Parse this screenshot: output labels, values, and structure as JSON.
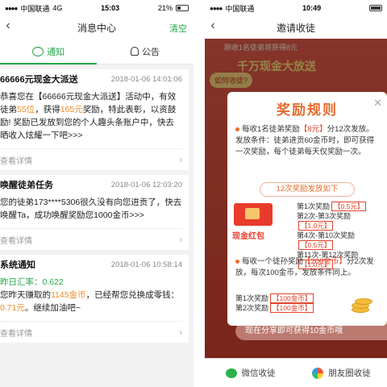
{
  "left": {
    "status": {
      "carrier": "中国联通",
      "network": "4G",
      "time": "15:03",
      "battery": "21%"
    },
    "nav": {
      "title": "消息中心",
      "action": "清空"
    },
    "tabs": [
      {
        "label": "通知"
      },
      {
        "label": "公告"
      }
    ],
    "cards": [
      {
        "title": "66666元现金大派送",
        "time": "2018-01-06 14:01:06",
        "body_parts": [
          "恭喜您在【66666元现金大派送】活动中，有效徒弟",
          "55位",
          "，获得",
          "165元",
          "奖励，特此表彰，以资鼓励! 奖励已发放到您的个人趣头条账户中，快去晒收入炫耀一下吧>>>"
        ],
        "more": "查看详情"
      },
      {
        "title": "唤醒徒弟任务",
        "time": "2018-01-06 12:03:20",
        "body": "您的徒弟173****5306很久没有向您进贡了，快去唤醒Ta，成功唤醒奖励您1000金币>>>",
        "more": "查看详情"
      },
      {
        "title": "系统通知",
        "time": "2018-01-06 10:58:14",
        "rate_label": "昨日汇率：0.622",
        "body_parts": [
          "您昨天赚取的",
          "1145金币",
          "，已经帮您兑换成零钱：",
          "0.71元",
          "。继续加油吧~"
        ],
        "more": "查看详情"
      }
    ]
  },
  "right": {
    "status": {
      "carrier": "中国联通",
      "time": "10:49"
    },
    "nav": {
      "title": "邀请收徒"
    },
    "ticker": "刚收1名徒弟将获得8元",
    "banner_title": "千万现金大放送",
    "how_label": "如何收徒?",
    "modal": {
      "title": "奖励规则",
      "rule1_parts": [
        "每收1名徒弟奖励",
        "【8元】",
        "分12次发放。发放条件：徒弟进贡60金币时，即可获得一次奖励，每个徒弟每天仅奖励一次。"
      ],
      "pill": "12次奖励发放如下",
      "list": [
        {
          "label": "第1次奖励",
          "value": "【0.5元】"
        },
        {
          "label": "第2次-第3次奖励",
          "value": "【1.0元】"
        },
        {
          "label": "第4次-第10次奖励",
          "value": "【0.5元】"
        },
        {
          "label": "第11次-第12次奖励",
          "value": "【1.0元】"
        }
      ],
      "packet_label": "现金红包",
      "rule2_parts": [
        "每收一个徒孙奖励",
        "【200金币】",
        "分2次发放，每次100金币，发放条件同上。"
      ],
      "list2": [
        {
          "label": "第1次奖励",
          "value": "【100金币】"
        },
        {
          "label": "第2次奖励",
          "value": "【100金币】"
        }
      ]
    },
    "share_bar": "现在分享即可获得10金币哦",
    "bottom": [
      {
        "label": "微信收徒"
      },
      {
        "label": "朋友圈收徒"
      }
    ]
  }
}
